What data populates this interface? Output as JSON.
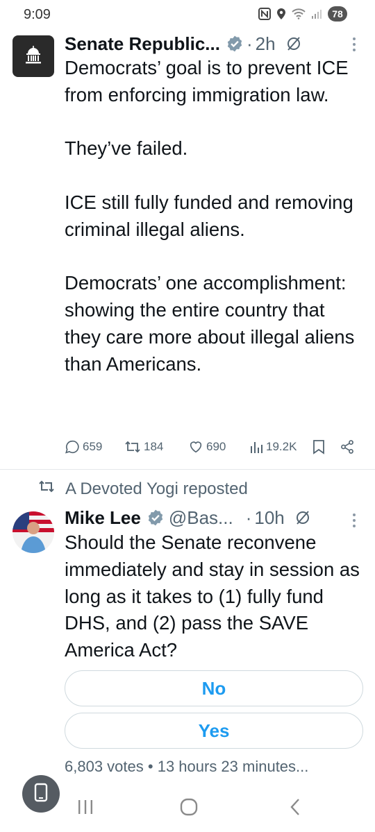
{
  "status_bar": {
    "time": "9:09",
    "battery": "78",
    "icons": [
      "nfc-icon",
      "location-icon",
      "wifi-icon",
      "signal-icon"
    ]
  },
  "tweet1": {
    "author_name": "Senate Republic...",
    "verified": true,
    "separator": "·",
    "time": "2h",
    "avatar_icon": "capitol-icon",
    "text": {
      "p1": "Democrats’ goal is to prevent ICE from enforcing immigration law.",
      "p2": "They’ve failed.",
      "p3": "ICE still fully funded and removing criminal illegal aliens.",
      "p4": "Democrats’ one accomplishment: showing the entire country that they care more about illegal aliens than Americans."
    },
    "actions": {
      "replies": "659",
      "reposts": "184",
      "likes": "690",
      "views": "19.2K"
    }
  },
  "repost_banner": {
    "text": "A Devoted Yogi reposted"
  },
  "tweet2": {
    "author_name": "Mike Lee",
    "verified": true,
    "handle": "@Bas...",
    "separator": "·",
    "time": "10h",
    "text": "Should the Senate reconvene immediately and stay in session as long as it takes to (1) fully fund DHS, and (2) pass the SAVE America Act?",
    "poll": {
      "options": [
        "No",
        "Yes"
      ],
      "votes": "6,803 votes",
      "meta_separator": "•",
      "time_left": "13 hours 23 minutes..."
    }
  },
  "colors": {
    "accent": "#1d9bf0",
    "text": "#0f1419",
    "secondary": "#536471",
    "border": "#cfd9de"
  }
}
